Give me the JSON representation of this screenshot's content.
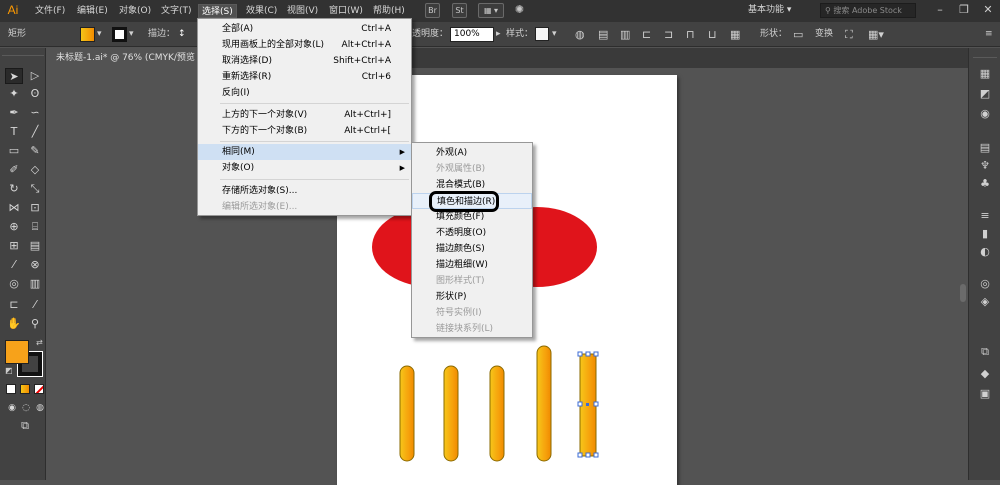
{
  "app": {
    "logo": "Ai"
  },
  "menubar": {
    "items": [
      {
        "label": "文件(F)"
      },
      {
        "label": "编辑(E)"
      },
      {
        "label": "对象(O)"
      },
      {
        "label": "文字(T)"
      },
      {
        "label": "选择(S)"
      },
      {
        "label": "效果(C)"
      },
      {
        "label": "视图(V)"
      },
      {
        "label": "窗口(W)"
      },
      {
        "label": "帮助(H)"
      }
    ],
    "bridge_label": "Br",
    "stock_label": "St",
    "workspace": "基本功能",
    "search_placeholder": "搜索 Adobe Stock"
  },
  "controlbar": {
    "object_type": "矩形",
    "stroke_label": "描边：",
    "opacity_label": "透明度：",
    "opacity_value": "100%",
    "style_label": "样式：",
    "shape_label": "形状：",
    "transform_label": "变换"
  },
  "document": {
    "tab_title": "未标题-1.ai* @ 76% (CMYK/预览"
  },
  "select_menu": {
    "items": [
      {
        "label": "全部(A)",
        "shortcut": "Ctrl+A",
        "disabled": false
      },
      {
        "label": "现用画板上的全部对象(L)",
        "shortcut": "Alt+Ctrl+A",
        "disabled": false
      },
      {
        "label": "取消选择(D)",
        "shortcut": "Shift+Ctrl+A",
        "disabled": false
      },
      {
        "label": "重新选择(R)",
        "shortcut": "Ctrl+6",
        "disabled": false
      },
      {
        "label": "反向(I)",
        "shortcut": "",
        "disabled": false
      },
      {
        "label": "上方的下一个对象(V)",
        "shortcut": "Alt+Ctrl+]",
        "disabled": false
      },
      {
        "label": "下方的下一个对象(B)",
        "shortcut": "Alt+Ctrl+[",
        "disabled": false
      },
      {
        "label": "相同(M)",
        "shortcut": "",
        "disabled": false,
        "submenu": true
      },
      {
        "label": "对象(O)",
        "shortcut": "",
        "disabled": false,
        "submenu": true
      },
      {
        "label": "存储所选对象(S)...",
        "shortcut": "",
        "disabled": false
      },
      {
        "label": "编辑所选对象(E)...",
        "shortcut": "",
        "disabled": true
      }
    ]
  },
  "same_submenu": {
    "items": [
      {
        "label": "外观(A)",
        "disabled": false
      },
      {
        "label": "外观属性(B)",
        "disabled": true
      },
      {
        "label": "混合模式(B)",
        "disabled": false
      },
      {
        "label": "填色和描边(R)",
        "disabled": false,
        "highlighted": true
      },
      {
        "label": "填充颜色(F)",
        "disabled": false
      },
      {
        "label": "不透明度(O)",
        "disabled": false
      },
      {
        "label": "描边颜色(S)",
        "disabled": false
      },
      {
        "label": "描边粗细(W)",
        "disabled": false
      },
      {
        "label": "图形样式(T)",
        "disabled": true
      },
      {
        "label": "形状(P)",
        "disabled": false
      },
      {
        "label": "符号实例(I)",
        "disabled": true
      },
      {
        "label": "链接块系列(L)",
        "disabled": true
      }
    ]
  },
  "colors": {
    "red_shape": "#e0141b",
    "fill_swatch": "#f7a21a",
    "menu_highlight_ring": "#000000",
    "accent_orange": "#ff9a00"
  },
  "tools": {
    "icons": [
      "selection-tool-icon",
      "direct-selection-tool-icon",
      "magic-wand-icon",
      "lasso-icon",
      "pen-icon",
      "curvature-icon",
      "type-icon",
      "line-icon",
      "rectangle-icon",
      "paintbrush-icon",
      "shaper-icon",
      "eraser-icon",
      "rotate-icon",
      "scale-icon",
      "width-icon",
      "free-transform-icon",
      "shape-builder-icon",
      "perspective-icon",
      "mesh-icon",
      "gradient-icon",
      "eyedropper-icon",
      "blend-icon",
      "symbol-sprayer-icon",
      "graph-icon",
      "artboard-icon",
      "slice-icon",
      "hand-icon",
      "zoom-icon"
    ]
  }
}
